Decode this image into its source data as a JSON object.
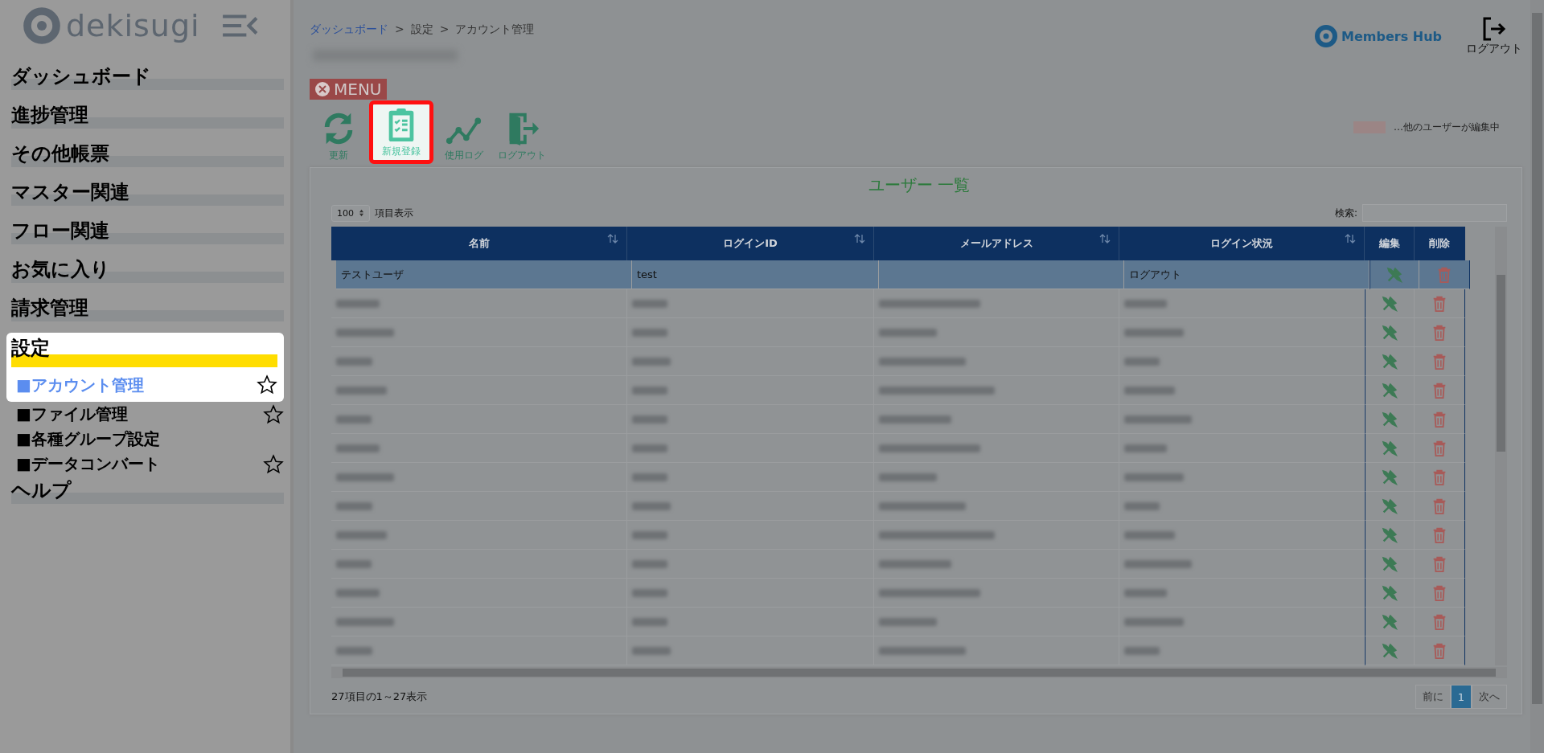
{
  "sidebar": {
    "logo": "dekisugi",
    "items": [
      {
        "label": "ダッシュボード",
        "expanded": false
      },
      {
        "label": "進捗管理",
        "expanded": false
      },
      {
        "label": "その他帳票",
        "expanded": false
      },
      {
        "label": "マスター関連",
        "expanded": false
      },
      {
        "label": "フロー関連",
        "expanded": false
      },
      {
        "label": "お気に入り",
        "expanded": false
      },
      {
        "label": "請求管理",
        "expanded": false
      },
      {
        "label": "設定",
        "expanded": true,
        "children": [
          {
            "label": "■アカウント管理",
            "selected": true,
            "star": true
          },
          {
            "label": "■ファイル管理",
            "selected": false,
            "star": true
          },
          {
            "label": "■各種グループ設定",
            "selected": false,
            "star": false
          },
          {
            "label": "■データコンバート",
            "selected": false,
            "star": true
          }
        ]
      },
      {
        "label": "ヘルプ",
        "expanded": false
      }
    ]
  },
  "header": {
    "breadcrumb": [
      {
        "label": "ダッシュボード",
        "link": true
      },
      {
        "label": ">",
        "link": false
      },
      {
        "label": "設定",
        "link": false
      },
      {
        "label": ">",
        "link": false
      },
      {
        "label": "アカウント管理",
        "link": false
      }
    ],
    "brand": "Members Hub",
    "logout": "ログアウト"
  },
  "toolbar": {
    "menu_badge": "MENU",
    "buttons": [
      {
        "label": "更新",
        "kind": "refresh",
        "highlighted": false
      },
      {
        "label": "新規登録",
        "kind": "register",
        "highlighted": true
      },
      {
        "label": "使用ログ",
        "kind": "log",
        "highlighted": false
      },
      {
        "label": "ログアウト",
        "kind": "logout",
        "highlighted": false
      }
    ]
  },
  "legend": {
    "color": "#9b8585",
    "text": "…他のユーザーが編集中"
  },
  "table": {
    "title": "ユーザー 一覧",
    "page_length": "100",
    "page_length_label": "項目表示",
    "search_label": "検索:",
    "columns": [
      {
        "label": "名前",
        "sortable": true
      },
      {
        "label": "ログインID",
        "sortable": true
      },
      {
        "label": "メールアドレス",
        "sortable": true
      },
      {
        "label": "ログイン状況",
        "sortable": true
      },
      {
        "label": "編集",
        "sortable": false
      },
      {
        "label": "削除",
        "sortable": false
      }
    ],
    "rows": [
      {
        "selected": true,
        "blurred": false,
        "cells": [
          "テストユーザ",
          "test",
          "",
          "ログアウト"
        ]
      },
      {
        "selected": false,
        "blurred": true
      },
      {
        "selected": false,
        "blurred": true
      },
      {
        "selected": false,
        "blurred": true
      },
      {
        "selected": false,
        "blurred": true
      },
      {
        "selected": false,
        "blurred": true
      },
      {
        "selected": false,
        "blurred": true
      },
      {
        "selected": false,
        "blurred": true
      },
      {
        "selected": false,
        "blurred": true
      },
      {
        "selected": false,
        "blurred": true
      },
      {
        "selected": false,
        "blurred": true
      },
      {
        "selected": false,
        "blurred": true
      },
      {
        "selected": false,
        "blurred": true
      },
      {
        "selected": false,
        "blurred": true
      }
    ],
    "info": "27項目の1～27表示",
    "pagination": [
      {
        "label": "前に",
        "selected": false
      },
      {
        "label": "1",
        "selected": true
      },
      {
        "label": "次へ",
        "selected": false
      }
    ]
  }
}
